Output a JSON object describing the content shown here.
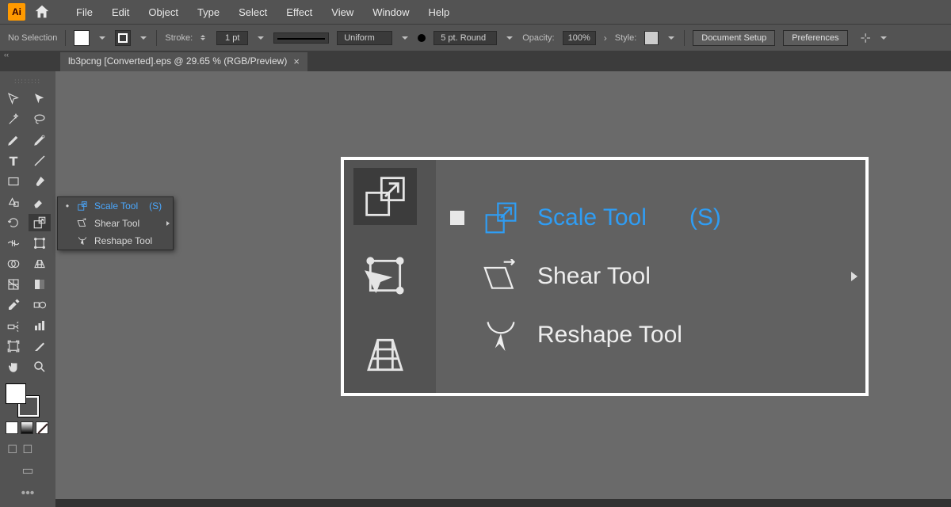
{
  "menu": {
    "items": [
      "File",
      "Edit",
      "Object",
      "Type",
      "Select",
      "Effect",
      "View",
      "Window",
      "Help"
    ]
  },
  "options": {
    "selection": "No Selection",
    "stroke_label": "Stroke:",
    "stroke_value": "1 pt",
    "profile": "Uniform",
    "brush": "5 pt. Round",
    "opacity_label": "Opacity:",
    "opacity_value": "100%",
    "style_label": "Style:",
    "doc_setup": "Document Setup",
    "prefs": "Preferences"
  },
  "doc": {
    "title": "lb3pcng [Converted].eps @ 29.65 % (RGB/Preview)"
  },
  "flyout_small": {
    "items": [
      {
        "label": "Scale Tool",
        "shortcut": "(S)",
        "selected": true
      },
      {
        "label": "Shear Tool",
        "submenu": true
      },
      {
        "label": "Reshape Tool"
      }
    ]
  },
  "flyout_big": {
    "items": [
      {
        "label": "Scale Tool",
        "shortcut": "(S)",
        "selected": true
      },
      {
        "label": "Shear Tool",
        "submenu": true
      },
      {
        "label": "Reshape Tool"
      }
    ]
  },
  "colors": {
    "accent": "#2f9df4"
  }
}
